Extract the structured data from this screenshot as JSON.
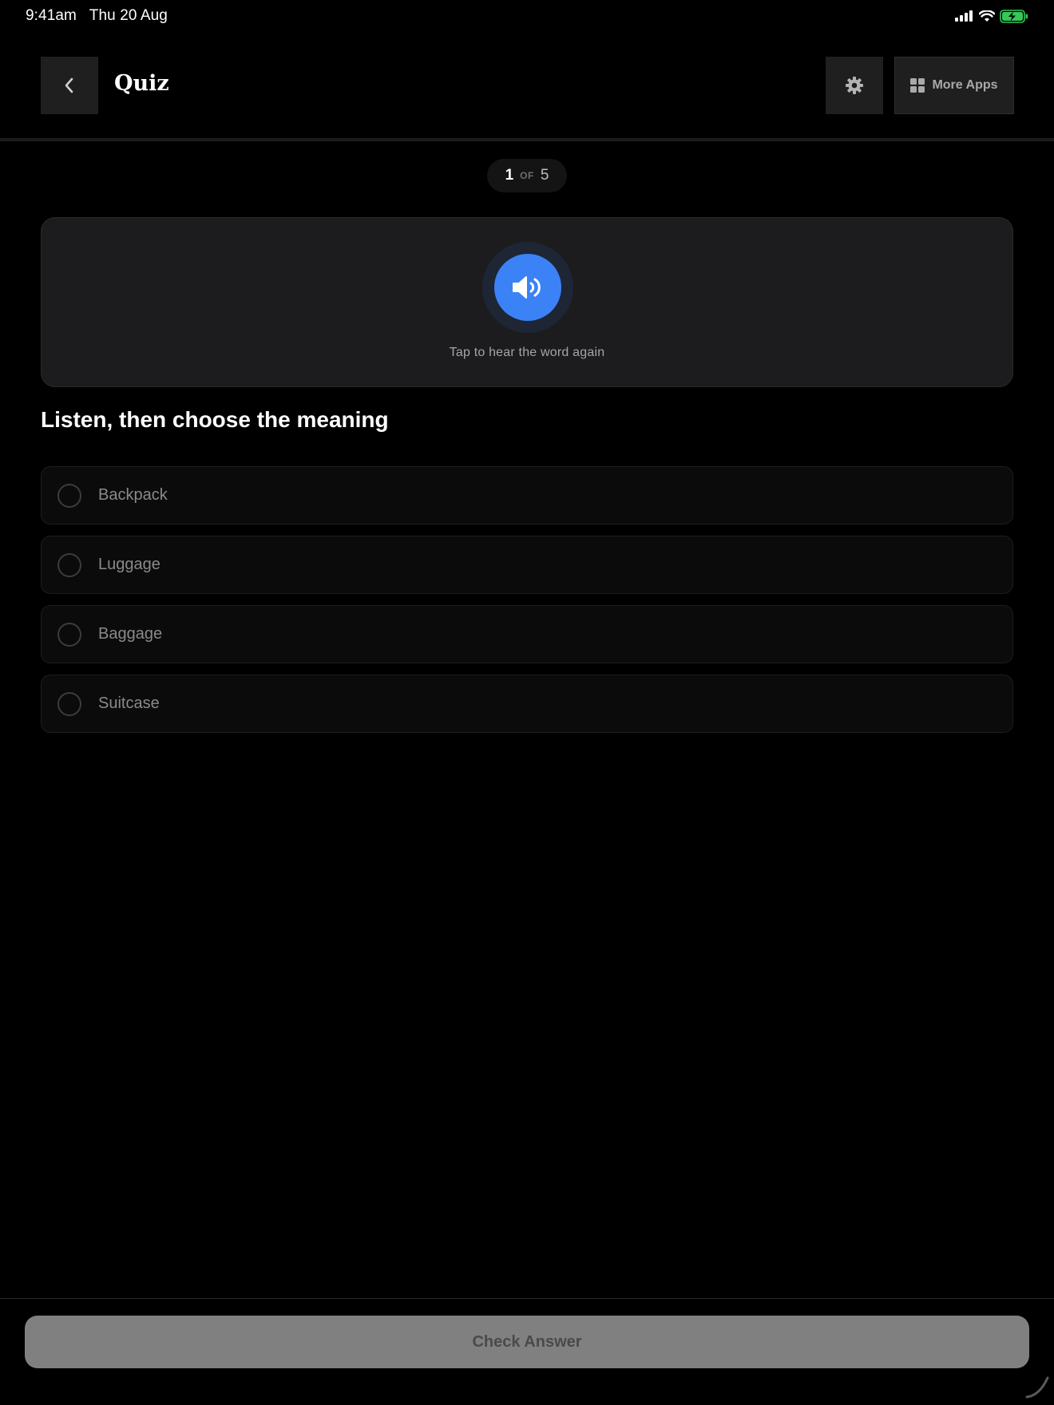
{
  "status_bar": {
    "time": "9:41am",
    "date": "Thu 20 Aug",
    "icons": [
      "cellular-signal-icon",
      "wifi-icon",
      "battery-charging-icon"
    ],
    "battery_color": "#34c759"
  },
  "header": {
    "title": "Quiz",
    "back_icon": "chevron-left-icon",
    "settings_icon": "gear-icon",
    "more_apps_icon": "grid-icon",
    "more_apps_label": "More Apps"
  },
  "progress": {
    "current": "1",
    "of_label": "OF",
    "total": "5"
  },
  "audio_card": {
    "icon": "speaker-icon",
    "hint": "Tap to hear the word again",
    "accent_color": "#3b82f6"
  },
  "question": {
    "title": "Listen, then choose the meaning",
    "options": [
      {
        "label": "Backpack",
        "selected": false
      },
      {
        "label": "Luggage",
        "selected": false
      },
      {
        "label": "Baggage",
        "selected": false
      },
      {
        "label": "Suitcase",
        "selected": false
      }
    ]
  },
  "footer": {
    "check_label": "Check Answer",
    "enabled": false
  }
}
